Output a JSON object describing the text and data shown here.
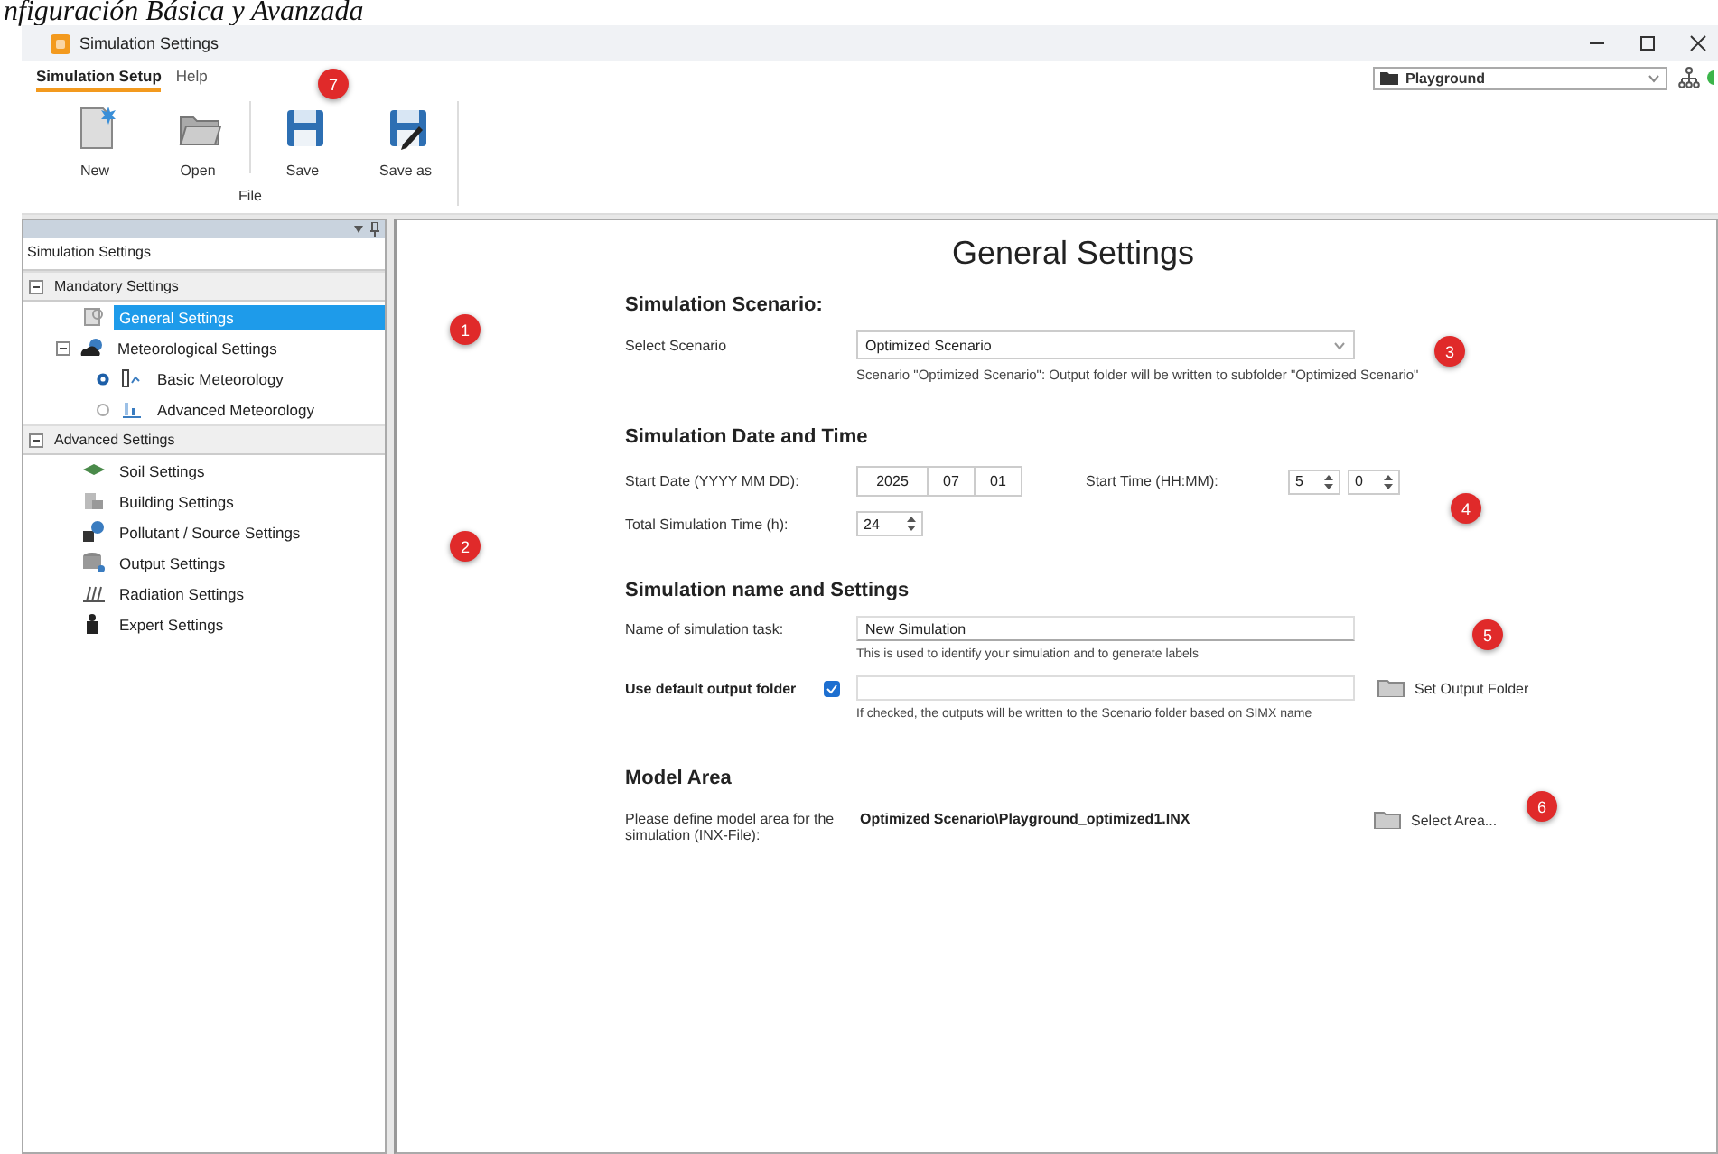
{
  "caption": "nfiguración Básica y Avanzada",
  "window": {
    "title": "Simulation Settings"
  },
  "menu_tabs": [
    {
      "label": "Simulation Setup",
      "selected": true
    },
    {
      "label": "Help",
      "selected": false
    }
  ],
  "ribbon": {
    "group_label": "File",
    "buttons": [
      {
        "label": "New",
        "kind": "new"
      },
      {
        "label": "Open",
        "kind": "open"
      },
      {
        "label": "Save",
        "kind": "save"
      },
      {
        "label": "Save as",
        "kind": "saveas"
      }
    ]
  },
  "project_selector": {
    "value": "Playground"
  },
  "panel": {
    "title": "Simulation Settings"
  },
  "tree": [
    {
      "label": "Mandatory Settings",
      "kind": "group",
      "expanded": true,
      "selected": false,
      "children": [
        {
          "label": "General Settings",
          "kind": "item",
          "selected": true
        },
        {
          "label": "Meteorological Settings",
          "kind": "item",
          "expanded": true,
          "selected": false,
          "children": [
            {
              "label": "Basic Meteorology",
              "kind": "radio",
              "checked": true,
              "selected": false
            },
            {
              "label": "Advanced Meteorology",
              "kind": "radio",
              "checked": false,
              "selected": false
            }
          ]
        }
      ]
    },
    {
      "label": "Advanced Settings",
      "kind": "group",
      "expanded": true,
      "selected": false,
      "children": [
        {
          "label": "Soil Settings",
          "kind": "item",
          "selected": false
        },
        {
          "label": "Building Settings",
          "kind": "item",
          "selected": false
        },
        {
          "label": "Pollutant / Source Settings",
          "kind": "item",
          "selected": false
        },
        {
          "label": "Output Settings",
          "kind": "item",
          "selected": false
        },
        {
          "label": "Radiation Settings",
          "kind": "item",
          "selected": false
        },
        {
          "label": "Expert Settings",
          "kind": "item",
          "selected": false
        }
      ]
    }
  ],
  "form": {
    "heading": "General Settings",
    "scenario": {
      "heading": "Simulation Scenario:",
      "label": "Select Scenario",
      "value": "Optimized Scenario",
      "note": "Scenario \"Optimized Scenario\": Output folder will be written to subfolder \"Optimized Scenario\""
    },
    "date_time": {
      "heading": "Simulation Date and Time",
      "date_label": "Start Date (YYYY MM DD):",
      "date_parts": [
        "2025",
        "07",
        "01"
      ],
      "time_label": "Start Time (HH:MM):",
      "hours": "5",
      "minutes": "0",
      "total_label": "Total Simulation Time (h):",
      "total": "24"
    },
    "name_settings": {
      "heading": "Simulation name and Settings",
      "task_label": "Name of simulation task:",
      "task_value": "New Simulation",
      "task_hint": "This is used to identify your simulation and to generate labels",
      "folder_label": "Use default output folder",
      "folder_checked": true,
      "folder_hint": "If checked, the outputs will be written to the Scenario folder based on SIMX name",
      "folder_button": "Set Output Folder"
    },
    "model_area": {
      "heading": "Model Area",
      "label": "Please define model area for the simulation (INX-File):",
      "path": "Optimized Scenario\\Playground_optimized1.INX",
      "button": "Select Area..."
    }
  },
  "annotation_markers": [
    "1",
    "2",
    "3",
    "4",
    "5",
    "6",
    "7"
  ]
}
